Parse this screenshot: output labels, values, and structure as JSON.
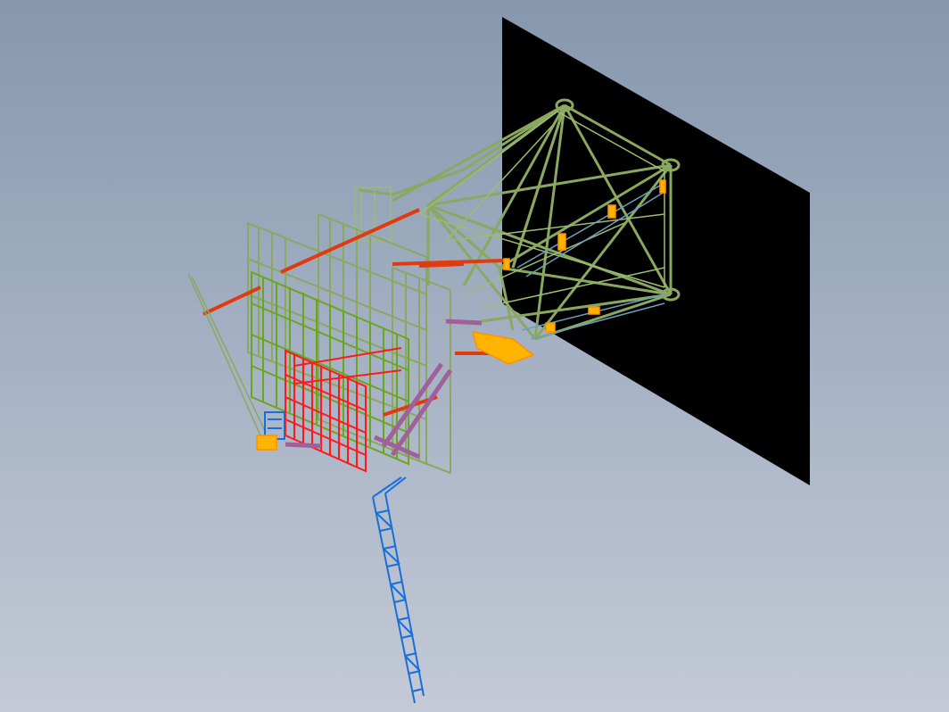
{
  "viewport": {
    "background_top": "#8697ad",
    "background_bottom": "#c4cad6"
  },
  "model": {
    "parts": [
      {
        "name": "back-plate",
        "color": "#000000"
      },
      {
        "name": "truss-frame",
        "color": "#8aa860"
      },
      {
        "name": "panel-frames",
        "color": "#6aa61e"
      },
      {
        "name": "bracket-assembly",
        "color": "#ff1a1a"
      },
      {
        "name": "tie-rods",
        "color": "#e03a10"
      },
      {
        "name": "duct-members",
        "color": "#a0609a"
      },
      {
        "name": "lattice-boom",
        "color": "#1a6ed8"
      },
      {
        "name": "fittings",
        "color": "#ffb400"
      },
      {
        "name": "cables",
        "color": "#6aa0c0"
      }
    ]
  }
}
